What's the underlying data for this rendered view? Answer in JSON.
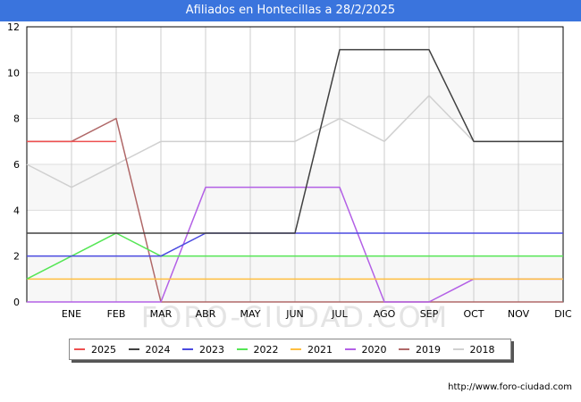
{
  "title": "Afiliados en Hontecillas a 28/2/2025",
  "watermark": "FORO-CIUDAD.COM",
  "footer_url": "http://www.foro-ciudad.com",
  "chart_data": {
    "type": "line",
    "title": "Afiliados en Hontecillas a 28/2/2025",
    "x_labels": [
      "",
      "ENE",
      "FEB",
      "MAR",
      "ABR",
      "MAY",
      "JUN",
      "JUL",
      "AGO",
      "SEP",
      "OCT",
      "NOV",
      "DIC"
    ],
    "y_ticks": [
      0,
      2,
      4,
      6,
      8,
      10,
      12
    ],
    "ylim": [
      0,
      12
    ],
    "grid": true,
    "legend_position": "bottom",
    "series": [
      {
        "name": "2018",
        "color": "#d0d0d0",
        "values": [
          6,
          5,
          6,
          7,
          7,
          7,
          7,
          8,
          7,
          9,
          7,
          7,
          7
        ]
      },
      {
        "name": "2019",
        "color": "#b06868",
        "values": [
          7,
          7,
          8,
          0,
          0,
          0,
          0,
          0,
          0,
          0,
          0,
          0,
          0
        ]
      },
      {
        "name": "2020",
        "color": "#b360e6",
        "values": [
          0,
          0,
          0,
          0,
          5,
          5,
          5,
          5,
          0,
          0,
          1,
          1,
          1
        ]
      },
      {
        "name": "2021",
        "color": "#ffbf40",
        "values": [
          1,
          1,
          1,
          1,
          1,
          1,
          1,
          1,
          1,
          1,
          1,
          1,
          1
        ]
      },
      {
        "name": "2022",
        "color": "#55e655",
        "values": [
          1,
          2,
          3,
          2,
          2,
          2,
          2,
          2,
          2,
          2,
          2,
          2,
          2
        ]
      },
      {
        "name": "2023",
        "color": "#4a4ae0",
        "values": [
          2,
          2,
          2,
          2,
          3,
          3,
          3,
          3,
          3,
          3,
          3,
          3,
          3
        ]
      },
      {
        "name": "2024",
        "color": "#404040",
        "values": [
          3,
          3,
          3,
          3,
          3,
          3,
          3,
          11,
          11,
          11,
          7,
          7,
          7
        ]
      },
      {
        "name": "2025",
        "color": "#ee5050",
        "values": [
          7,
          7,
          7
        ]
      }
    ],
    "legend_order": [
      "2025",
      "2024",
      "2023",
      "2022",
      "2021",
      "2020",
      "2019",
      "2018"
    ]
  }
}
